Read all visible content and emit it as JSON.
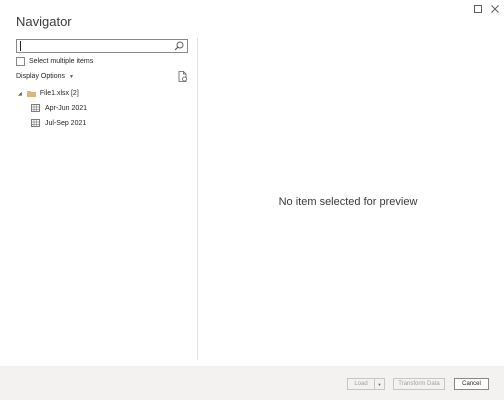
{
  "window": {
    "title": "Navigator",
    "maximize_icon": "maximize-icon",
    "close_icon": "close-icon"
  },
  "left_panel": {
    "search": {
      "value": "",
      "placeholder": ""
    },
    "select_multiple_label": "Select multiple items",
    "display_options_label": "Display Options",
    "tree": {
      "folder": {
        "label": "File1.xlsx [2]",
        "icon": "folder-icon"
      },
      "items": [
        {
          "label": "Apr-Jun 2021",
          "icon": "table-icon"
        },
        {
          "label": "Jul-Sep 2021",
          "icon": "table-icon"
        }
      ]
    }
  },
  "preview": {
    "message": "No item selected for preview"
  },
  "footer": {
    "load_label": "Load",
    "transform_label": "Transform Data",
    "cancel_label": "Cancel"
  },
  "colors": {
    "folder": "#dcb67a",
    "footer_bg": "#f3f2f1",
    "border": "#8a8886"
  }
}
